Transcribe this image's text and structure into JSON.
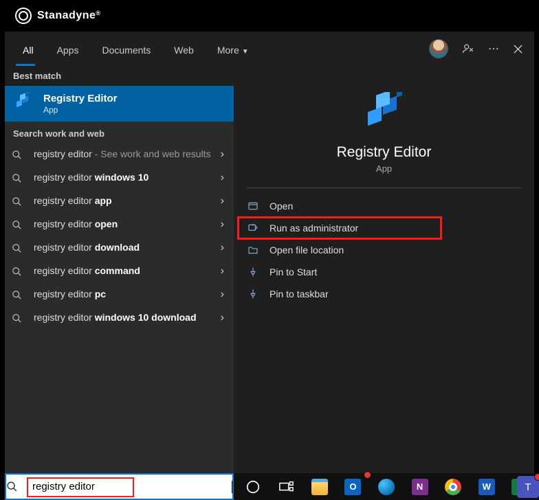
{
  "brand": {
    "name": "Stanadyne"
  },
  "tabs": {
    "items": [
      "All",
      "Apps",
      "Documents",
      "Web",
      "More"
    ],
    "active_index": 0
  },
  "best_match": {
    "section_label": "Best match",
    "title": "Registry Editor",
    "subtitle": "App"
  },
  "work_web_label": "Search work and web",
  "suggestions": [
    {
      "prefix": "registry editor",
      "bold": "",
      "suffix": " - See work and web results"
    },
    {
      "prefix": "registry editor ",
      "bold": "windows 10",
      "suffix": ""
    },
    {
      "prefix": "registry editor ",
      "bold": "app",
      "suffix": ""
    },
    {
      "prefix": "registry editor ",
      "bold": "open",
      "suffix": ""
    },
    {
      "prefix": "registry editor ",
      "bold": "download",
      "suffix": ""
    },
    {
      "prefix": "registry editor ",
      "bold": "command",
      "suffix": ""
    },
    {
      "prefix": "registry editor ",
      "bold": "pc",
      "suffix": ""
    },
    {
      "prefix": "registry editor ",
      "bold": "windows 10 download",
      "suffix": ""
    }
  ],
  "details": {
    "title": "Registry Editor",
    "subtitle": "App"
  },
  "actions": [
    {
      "label": "Open",
      "icon": "open",
      "highlight": false
    },
    {
      "label": "Run as administrator",
      "icon": "admin",
      "highlight": true
    },
    {
      "label": "Open file location",
      "icon": "folder",
      "highlight": false
    },
    {
      "label": "Pin to Start",
      "icon": "pin",
      "highlight": false
    },
    {
      "label": "Pin to taskbar",
      "icon": "pin",
      "highlight": false
    }
  ],
  "search": {
    "value": "registry editor"
  },
  "taskbar": {
    "items": [
      {
        "name": "cortana",
        "color": "#fff"
      },
      {
        "name": "taskview",
        "color": "#fff"
      },
      {
        "name": "explorer",
        "color": "#ffcc4d"
      },
      {
        "name": "outlook",
        "color": "#0a64c2"
      },
      {
        "name": "edge",
        "color": "#36c2b4"
      },
      {
        "name": "onenote",
        "color": "#7b2e8d"
      },
      {
        "name": "chrome",
        "color": "#ffffff"
      },
      {
        "name": "word",
        "color": "#185abd"
      },
      {
        "name": "excel",
        "color": "#107c41"
      }
    ],
    "overflow": "T"
  }
}
